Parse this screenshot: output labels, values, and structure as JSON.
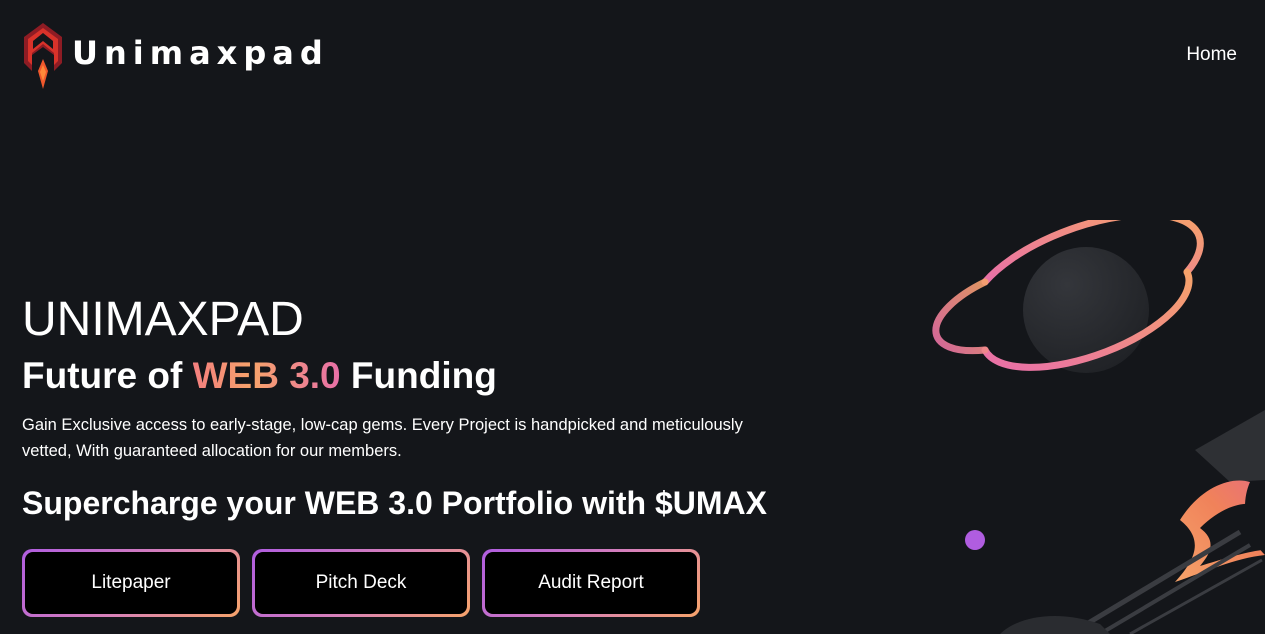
{
  "header": {
    "brand": "Unimaxpad",
    "nav": {
      "home": "Home"
    }
  },
  "hero": {
    "title": "UNIMAXPAD",
    "subtitle_prefix": "Future of ",
    "subtitle_highlight": "WEB 3.0",
    "subtitle_suffix": " Funding",
    "description": "Gain Exclusive access to early-stage, low-cap gems. Every Project is handpicked and meticulously vetted, With guaranteed allocation for our members.",
    "tagline": "Supercharge your WEB 3.0 Portfolio with $UMAX"
  },
  "buttons": {
    "litepaper": "Litepaper",
    "pitch_deck": "Pitch Deck",
    "audit_report": "Audit Report"
  },
  "colors": {
    "background": "#14161a",
    "logo_red": "#e8352c",
    "logo_dark_red": "#8e1c24",
    "highlight_start": "#f47f7f",
    "highlight_end": "#e86fa8",
    "button_border_start": "#b05de0",
    "button_border_end": "#f6a36a",
    "planet": "#2a2c31",
    "ring_start": "#e86fa8",
    "ring_end": "#f6a36a",
    "dot": "#b05de0"
  },
  "icons": {
    "logo": "rocket-logo-icon",
    "planet": "planet-icon",
    "rocket": "rocket-icon"
  }
}
